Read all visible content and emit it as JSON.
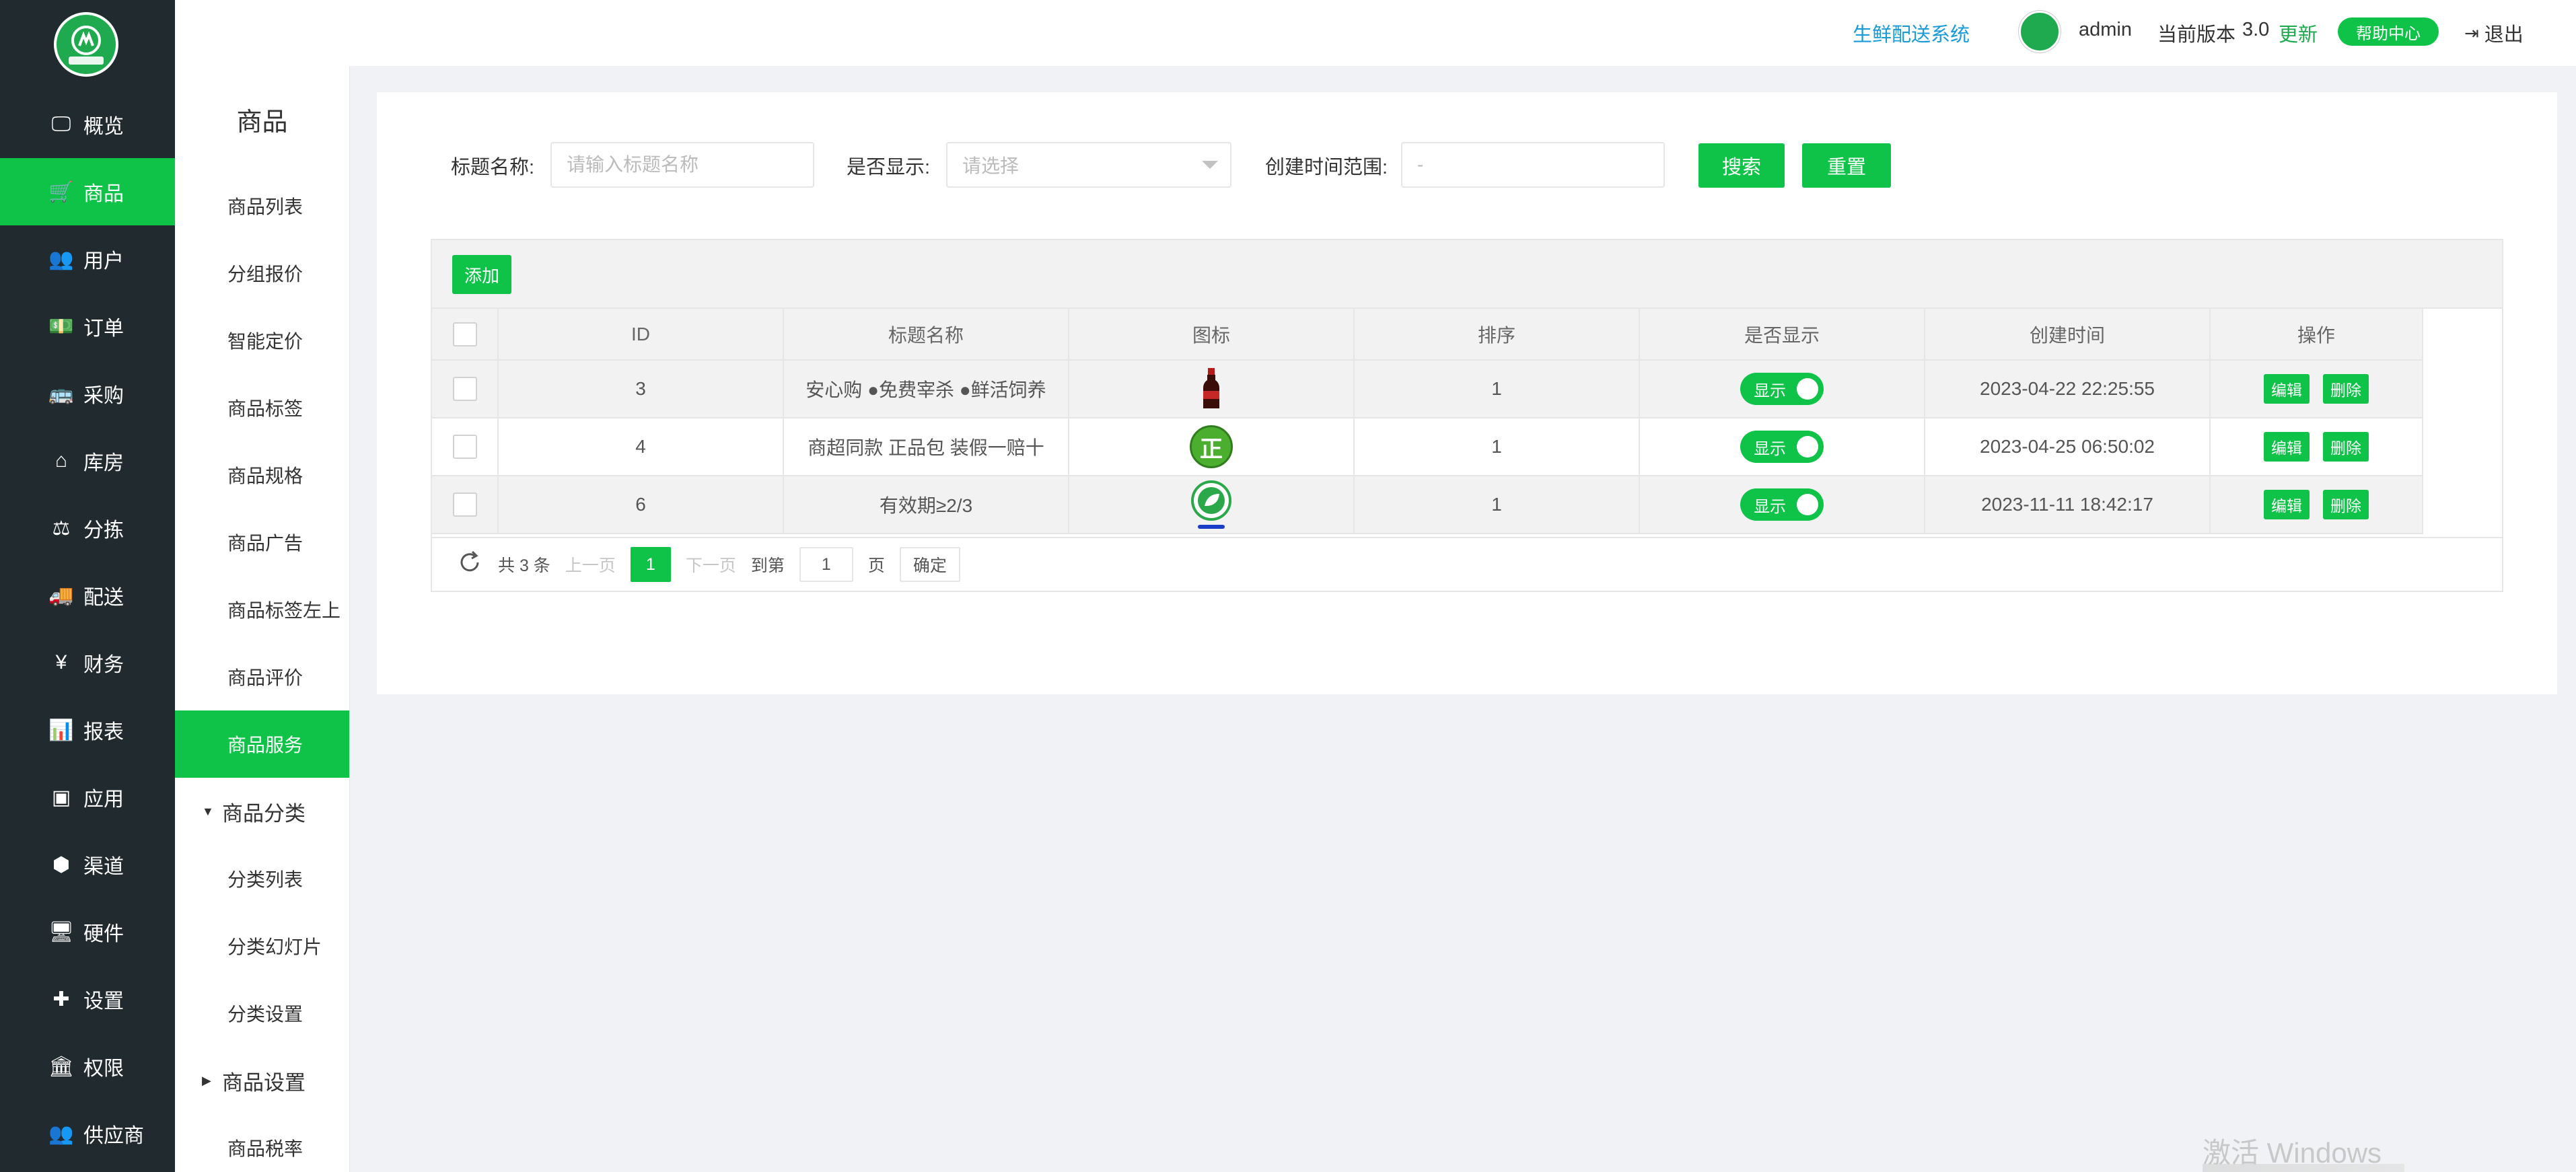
{
  "nav": {
    "logo_text": "万顺优选",
    "items": [
      {
        "label": "概览",
        "icon": "monitor-icon"
      },
      {
        "label": "商品",
        "icon": "cart-icon",
        "active": true
      },
      {
        "label": "用户",
        "icon": "users-icon"
      },
      {
        "label": "订单",
        "icon": "money-icon"
      },
      {
        "label": "采购",
        "icon": "bus-icon"
      },
      {
        "label": "库房",
        "icon": "home-icon"
      },
      {
        "label": "分拣",
        "icon": "scale-icon"
      },
      {
        "label": "配送",
        "icon": "truck-icon"
      },
      {
        "label": "财务",
        "icon": "yen-icon"
      },
      {
        "label": "报表",
        "icon": "bar-chart-icon"
      },
      {
        "label": "应用",
        "icon": "apps-icon"
      },
      {
        "label": "渠道",
        "icon": "cube-icon"
      },
      {
        "label": "硬件",
        "icon": "desktop-icon"
      },
      {
        "label": "设置",
        "icon": "puzzle-icon"
      },
      {
        "label": "权限",
        "icon": "bank-icon"
      },
      {
        "label": "供应商",
        "icon": "group-icon"
      }
    ]
  },
  "subnav": {
    "title": "商品",
    "items": [
      {
        "label": "商品列表"
      },
      {
        "label": "分组报价"
      },
      {
        "label": "智能定价"
      },
      {
        "label": "商品标签"
      },
      {
        "label": "商品规格"
      },
      {
        "label": "商品广告"
      },
      {
        "label": "商品标签左上"
      },
      {
        "label": "商品评价"
      },
      {
        "label": "商品服务",
        "active": true
      }
    ],
    "group1": "商品分类",
    "group1_items": [
      "分类列表",
      "分类幻灯片",
      "分类设置"
    ],
    "group2": "商品设置",
    "group2_items": [
      "商品税率"
    ]
  },
  "topbar": {
    "system_link": "生鲜配送系统",
    "user": "admin",
    "version_label": "当前版本",
    "version": "3.0",
    "update": "更新",
    "help": "帮助中心",
    "logout": "退出"
  },
  "filters": {
    "title_label": "标题名称:",
    "title_placeholder": "请输入标题名称",
    "show_label": "是否显示:",
    "show_placeholder": "请选择",
    "time_label": "创建时间范围:",
    "time_placeholder": "-",
    "search": "搜索",
    "reset": "重置"
  },
  "table": {
    "add": "添加",
    "columns": [
      "ID",
      "标题名称",
      "图标",
      "排序",
      "是否显示",
      "创建时间",
      "操作"
    ],
    "rows": [
      {
        "id": "3",
        "title": "安心购 ●免费宰杀 ●鲜活饲养",
        "icon": "bottle-icon",
        "sort": "1",
        "show": "显示",
        "created": "2023-04-22 22:25:55"
      },
      {
        "id": "4",
        "title": "商超同款 正品包 装假一赔十",
        "icon": "zheng-badge-icon",
        "icon_text": "正",
        "sort": "1",
        "show": "显示",
        "created": "2023-04-25 06:50:02"
      },
      {
        "id": "6",
        "title": "有效期≥2/3",
        "icon": "leaf-badge-icon",
        "sort": "1",
        "show": "显示",
        "created": "2023-11-11 18:42:17"
      }
    ],
    "edit": "编辑",
    "delete": "删除"
  },
  "pager": {
    "total": "共 3 条",
    "prev": "上一页",
    "current": "1",
    "next": "下一页",
    "goto": "到第",
    "goto_value": "1",
    "page_unit": "页",
    "confirm": "确定"
  },
  "watermark": "激活 Windows",
  "colors": {
    "accent": "#0ec347",
    "nav_bg": "#202a2f",
    "link": "#1a9bd7"
  }
}
